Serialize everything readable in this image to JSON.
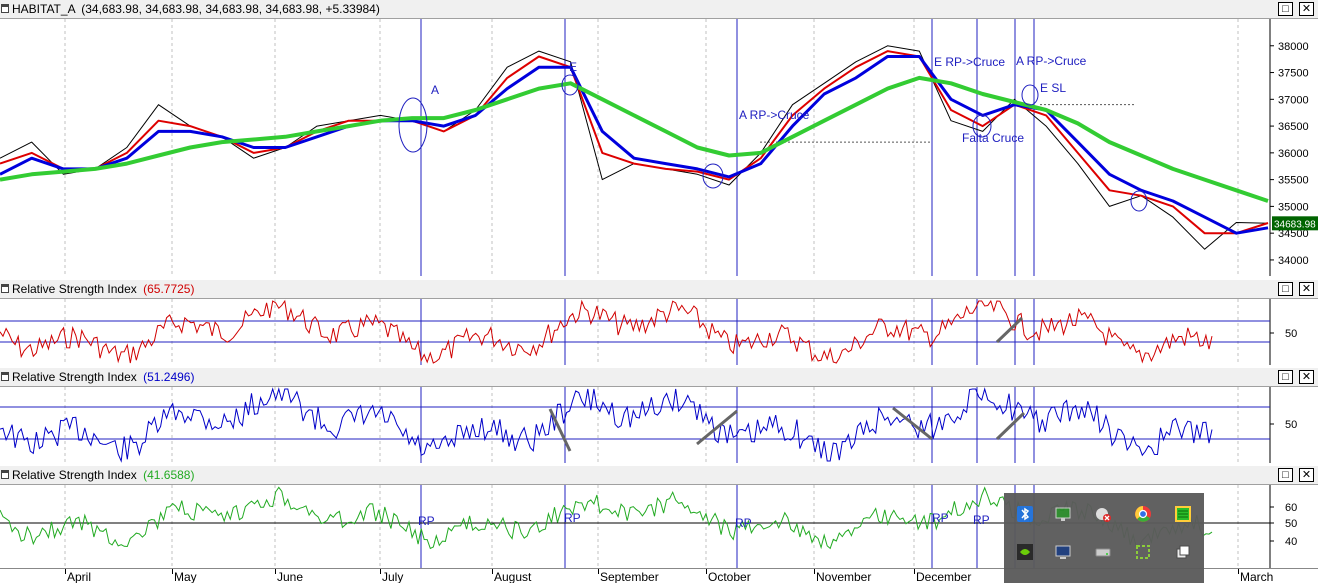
{
  "main_pane": {
    "title": "HABITAT_A",
    "values": "(34,683.98, 34,683.98, 34,683.98, 34,683.98, +5.33984)",
    "last_price": "34683.98"
  },
  "rsi_panes": [
    {
      "title": "Relative Strength Index",
      "value": "(65.7725)",
      "color": "#d00000",
      "levels": [
        70,
        30
      ],
      "y_labels": [
        "50"
      ]
    },
    {
      "title": "Relative Strength Index",
      "value": "(51.2496)",
      "color": "#0000c8",
      "levels": [
        70,
        30
      ],
      "y_labels": [
        "50"
      ]
    },
    {
      "title": "Relative Strength Index",
      "value": "(41.6588)",
      "color": "#22aa22",
      "levels": [
        50
      ],
      "y_labels": [
        "60",
        "50",
        "40"
      ]
    }
  ],
  "annotations": {
    "A": "A",
    "E": "E",
    "a_rp_cruce_oct": "A RP->Cruce",
    "e_rp_cruce": "E RP->Cruce",
    "a_rp_cruce_dec": "A RP->Cruce",
    "e_sl": "E SL",
    "falta_cruce": "Falta Cruce",
    "rp": "RP"
  },
  "time_axis": {
    "months": [
      "April",
      "May",
      "June",
      "July",
      "August",
      "September",
      "October",
      "November",
      "December",
      "March"
    ]
  },
  "window_buttons": {
    "restore": "□",
    "close": "✕"
  },
  "tray_icons": [
    "bluetooth-icon",
    "monitor-icon",
    "network-disabled-icon",
    "chrome-icon",
    "taskmanager-icon",
    "nvidia-icon",
    "display-icon",
    "drive-icon",
    "snippet-icon",
    "copy-icon"
  ],
  "chart_data": {
    "type": "line",
    "title": "HABITAT_A",
    "ylim": [
      33700,
      38500
    ],
    "y_ticks": [
      34000,
      34500,
      35000,
      35500,
      36000,
      36500,
      37000,
      37500,
      38000
    ],
    "x_months": [
      "April",
      "May",
      "June",
      "July",
      "August",
      "September",
      "October",
      "November",
      "December",
      "March"
    ],
    "series": [
      {
        "color": "#000000",
        "values": [
          35900,
          36200,
          35600,
          35700,
          36100,
          36900,
          36500,
          36300,
          35900,
          36100,
          36500,
          36600,
          36700,
          36600,
          36400,
          36800,
          37600,
          37900,
          37700,
          35500,
          35800,
          35700,
          35600,
          35400,
          36000,
          36900,
          37300,
          37700,
          38000,
          37900,
          36600,
          36400,
          37000,
          36500,
          35800,
          35000,
          35200,
          34800,
          34200,
          34700,
          34683.98
        ]
      },
      {
        "color": "#dd0000",
        "values": [
          35800,
          36000,
          35700,
          35700,
          36000,
          36600,
          36500,
          36300,
          36000,
          36100,
          36400,
          36600,
          36600,
          36600,
          36400,
          36700,
          37400,
          37800,
          37600,
          36000,
          35800,
          35700,
          35650,
          35500,
          35900,
          36700,
          37200,
          37600,
          37900,
          37800,
          36800,
          36500,
          36900,
          36700,
          36000,
          35300,
          35200,
          35000,
          34500,
          34500,
          34690
        ]
      },
      {
        "color": "#0000dd",
        "values": [
          35600,
          35900,
          35700,
          35700,
          35900,
          36400,
          36400,
          36300,
          36100,
          36100,
          36300,
          36500,
          36600,
          36600,
          36500,
          36700,
          37200,
          37600,
          37600,
          36400,
          35900,
          35800,
          35700,
          35550,
          35800,
          36500,
          37100,
          37400,
          37800,
          37800,
          37000,
          36700,
          36900,
          36800,
          36200,
          35600,
          35300,
          35100,
          34800,
          34500,
          34600
        ]
      },
      {
        "color": "#33cc33",
        "values": [
          35500,
          35600,
          35650,
          35700,
          35800,
          35950,
          36100,
          36200,
          36250,
          36300,
          36400,
          36500,
          36600,
          36650,
          36650,
          36800,
          37000,
          37200,
          37300,
          37000,
          36700,
          36400,
          36100,
          35950,
          36000,
          36300,
          36600,
          36900,
          37200,
          37400,
          37300,
          37100,
          36950,
          36800,
          36550,
          36200,
          35950,
          35700,
          35500,
          35300,
          35100
        ]
      }
    ]
  }
}
